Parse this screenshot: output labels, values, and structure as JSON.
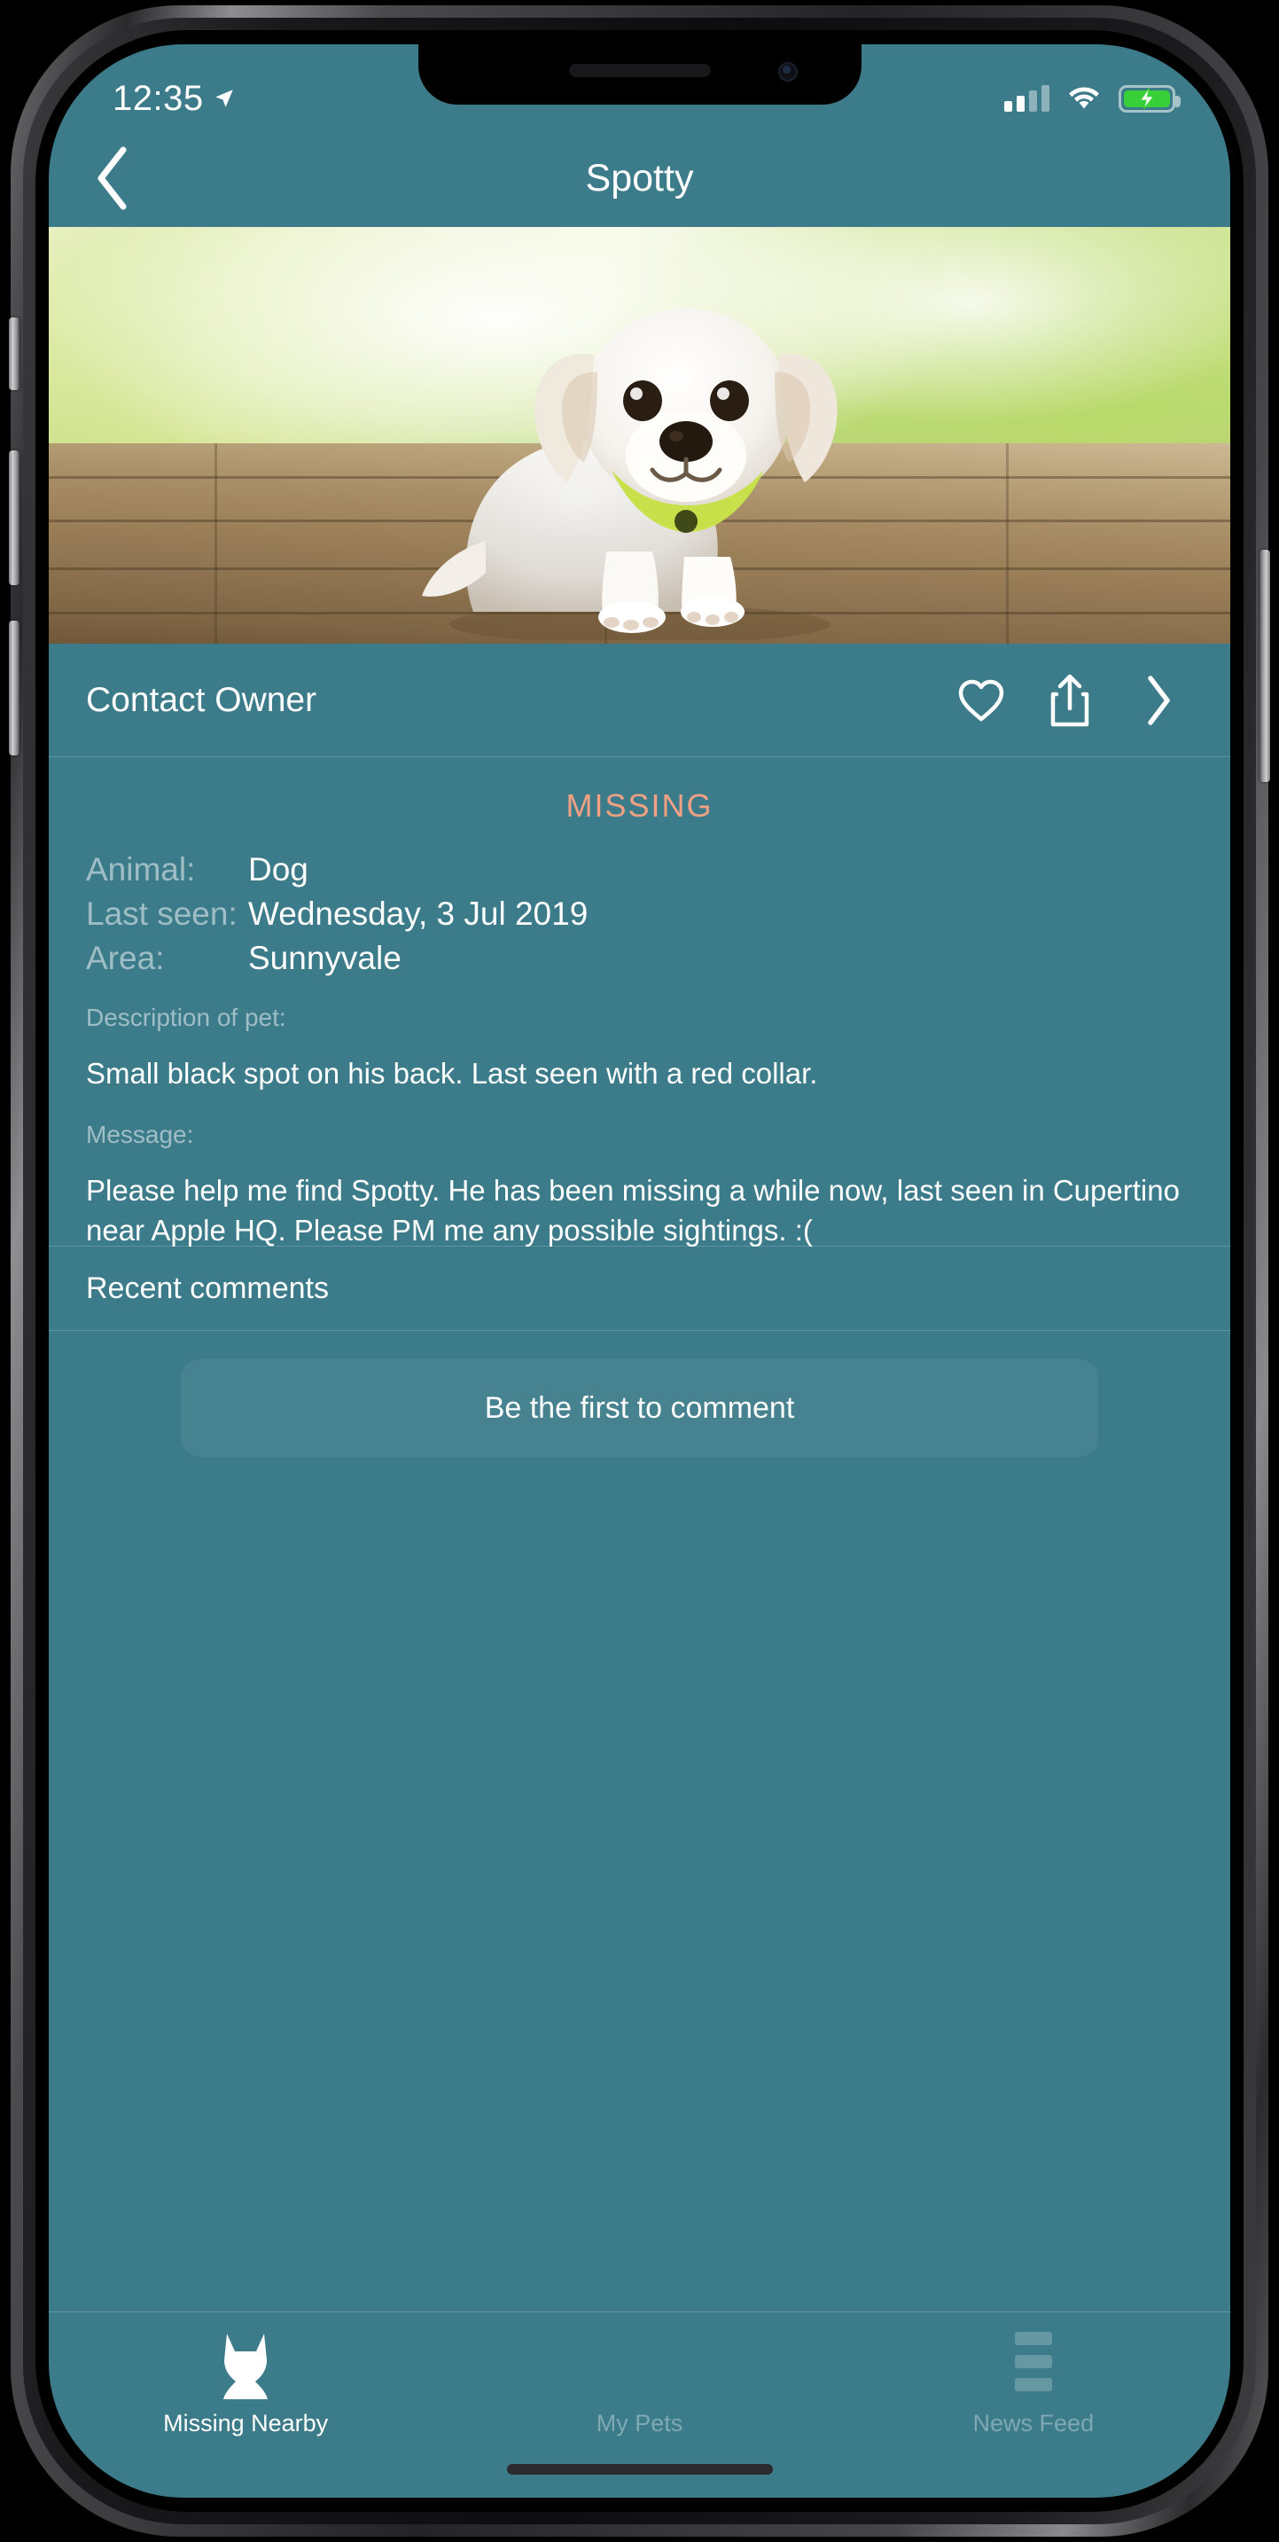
{
  "status_bar": {
    "time": "12:35",
    "location_icon": "location-arrow-icon",
    "signal_icon": "cellular-signal-icon",
    "signal_bars_filled": 2,
    "signal_bars_total": 4,
    "wifi_icon": "wifi-icon",
    "battery_icon": "battery-charging-icon",
    "battery_charging": true
  },
  "nav": {
    "back_icon": "chevron-left-icon",
    "title": "Spotty"
  },
  "hero": {
    "alt": "white puppy with green collar lying on wooden deck"
  },
  "contact": {
    "label": "Contact Owner",
    "favorite_icon": "heart-icon",
    "share_icon": "share-icon",
    "disclosure_icon": "chevron-right-icon"
  },
  "details": {
    "status_badge": "MISSING",
    "status_color": "#F0A183",
    "fields": [
      {
        "key": "Animal:",
        "value": "Dog"
      },
      {
        "key": "Last seen:",
        "value": "Wednesday, 3 Jul 2019"
      },
      {
        "key": "Area:",
        "value": "Sunnyvale"
      }
    ],
    "description_label": "Description of  pet:",
    "description_text": "Small black spot on his back. Last seen with a red collar.",
    "message_label": "Message:",
    "message_text": "Please help me find Spotty. He has been missing a while now, last seen in Cupertino near Apple HQ. Please PM me any possible sightings. :("
  },
  "comments": {
    "heading": "Recent comments",
    "empty_button": "Be the first to comment"
  },
  "tabbar": {
    "items": [
      {
        "label": "Missing Nearby",
        "icon": "cat-silhouette-icon",
        "active": true
      },
      {
        "label": "My Pets",
        "icon": "paw-arcs-icon",
        "active": false
      },
      {
        "label": "News Feed",
        "icon": "list-lines-icon",
        "active": false
      }
    ]
  },
  "theme": {
    "background": "#3C7B8A",
    "accent": "#F0A183",
    "text": "#FFFFFF"
  }
}
